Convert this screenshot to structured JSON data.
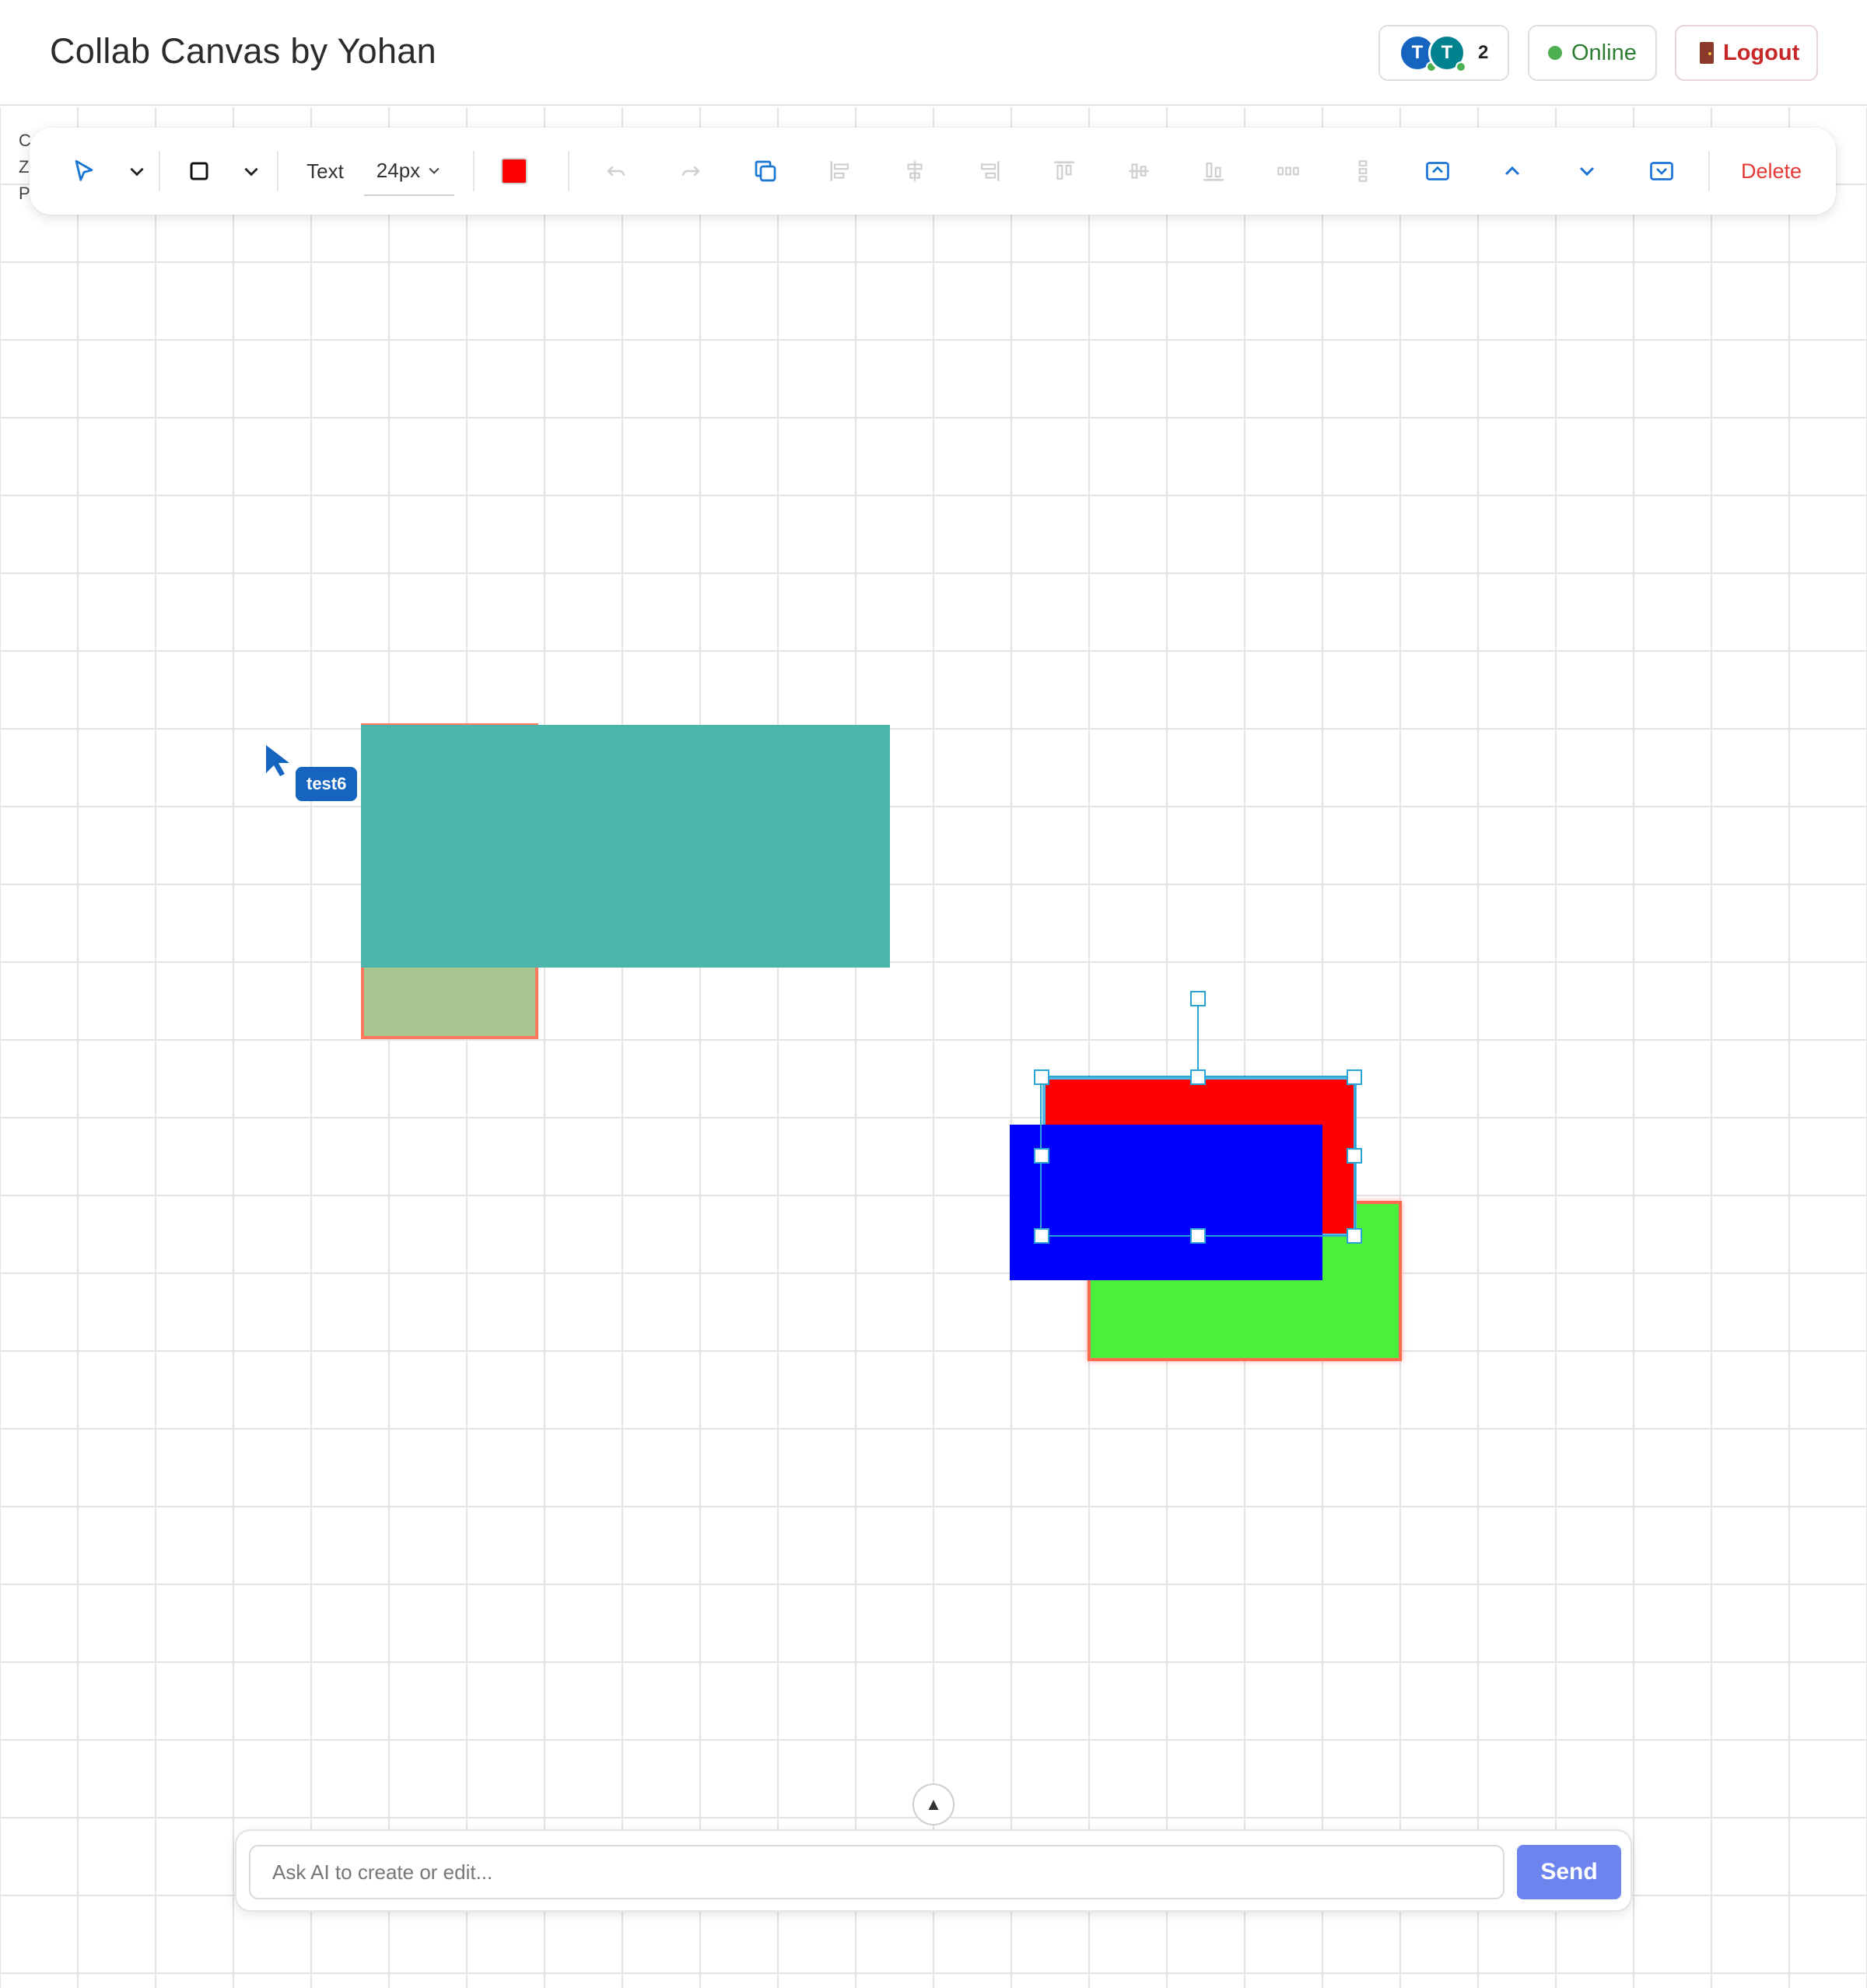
{
  "header": {
    "title": "Collab Canvas by Yohan",
    "presence": {
      "avatars": [
        {
          "initial": "T",
          "color": "#1565c0"
        },
        {
          "initial": "T",
          "color": "#00838f"
        }
      ],
      "count": "2"
    },
    "status": {
      "label": "Online",
      "color": "#4caf50"
    },
    "logout_label": "Logout"
  },
  "side_info": [
    "C",
    "Z",
    "P"
  ],
  "toolbar": {
    "tools": {
      "select_icon": "cursor-arrow-icon",
      "select_dropdown_icon": "chevron-down-icon",
      "shape_icon": "rectangle-icon",
      "shape_dropdown_icon": "chevron-down-icon"
    },
    "text_label": "Text",
    "font_size": "24px",
    "fill_color": "#ff0000",
    "actions": [
      {
        "name": "undo-icon",
        "enabled": false
      },
      {
        "name": "redo-icon",
        "enabled": false
      },
      {
        "name": "duplicate-icon",
        "enabled": true
      },
      {
        "name": "align-left-icon",
        "enabled": false
      },
      {
        "name": "align-center-horizontal-icon",
        "enabled": false
      },
      {
        "name": "align-right-icon",
        "enabled": false
      },
      {
        "name": "align-top-icon",
        "enabled": false
      },
      {
        "name": "align-middle-vertical-icon",
        "enabled": false
      },
      {
        "name": "align-bottom-icon",
        "enabled": false
      },
      {
        "name": "distribute-horizontal-icon",
        "enabled": false
      },
      {
        "name": "distribute-vertical-icon",
        "enabled": false
      },
      {
        "name": "bring-to-front-icon",
        "enabled": true
      },
      {
        "name": "bring-forward-icon",
        "enabled": true
      },
      {
        "name": "send-backward-icon",
        "enabled": true
      },
      {
        "name": "send-to-back-icon",
        "enabled": true
      }
    ],
    "delete_label": "Delete"
  },
  "canvas": {
    "shapes": [
      {
        "name": "olive-rectangle",
        "fill": "#a8c690",
        "stroke": "#ff7a5c"
      },
      {
        "name": "teal-rectangle",
        "fill": "#4db6ac",
        "stroke": "none"
      },
      {
        "name": "green-rectangle",
        "fill": "#4cef3c",
        "stroke": "#ff6b4f"
      },
      {
        "name": "red-rectangle",
        "fill": "#ff0000",
        "stroke": "#4fb8e8"
      },
      {
        "name": "blue-rectangle",
        "fill": "#0000ff",
        "stroke": "none"
      }
    ],
    "remote_cursor": {
      "user": "test6",
      "color": "#1565c0"
    },
    "selection_color": "#29a3d6"
  },
  "ai": {
    "collapse_symbol": "▲",
    "placeholder": "Ask AI to create or edit...",
    "send_label": "Send"
  }
}
